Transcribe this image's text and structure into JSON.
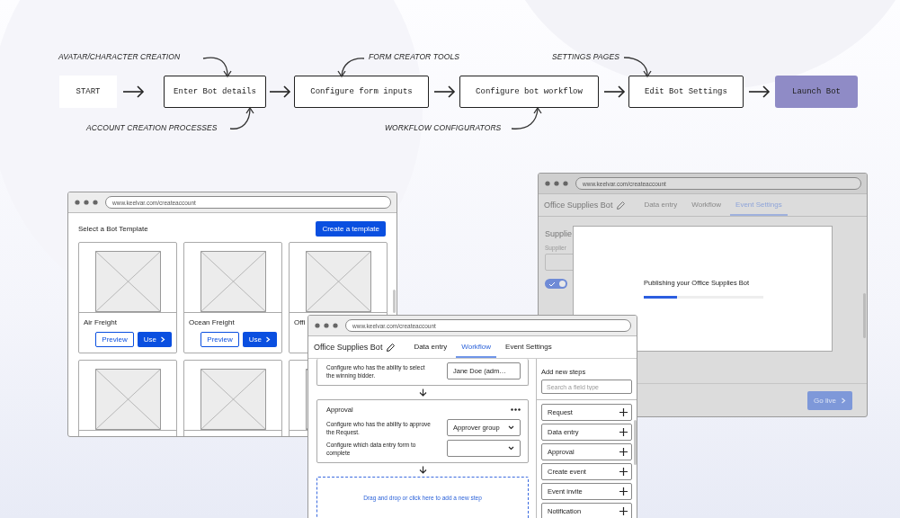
{
  "flow": {
    "steps": [
      {
        "label": "START",
        "kind": "start"
      },
      {
        "label": "Enter Bot details",
        "kind": "step"
      },
      {
        "label": "Configure form inputs",
        "kind": "step"
      },
      {
        "label": "Configure bot workflow",
        "kind": "step"
      },
      {
        "label": "Edit Bot Settings",
        "kind": "step"
      },
      {
        "label": "Launch Bot",
        "kind": "final"
      }
    ],
    "annotations": [
      {
        "text": "AVATAR/CHARACTER CREATION"
      },
      {
        "text": "ACCOUNT CREATION PROCESSES"
      },
      {
        "text": "FORM CREATOR TOOLS"
      },
      {
        "text": "WORKFLOW CONFIGURATORS"
      },
      {
        "text": "SETTINGS PAGES"
      }
    ]
  },
  "template_window": {
    "url": "www.keelvar.com/createaccount",
    "heading": "Select a Bot Template",
    "create_button": "Create a template",
    "cards": [
      {
        "kind": "template",
        "title": "Air Freight",
        "preview": "Preview",
        "use": "Use"
      },
      {
        "kind": "template",
        "title": "Ocean Freight",
        "preview": "Preview",
        "use": "Use"
      },
      {
        "kind": "template",
        "title": "Offi"
      },
      {
        "kind": "template"
      },
      {
        "kind": "template"
      },
      {
        "kind": "template"
      }
    ]
  },
  "settings_window": {
    "url": "www.keelvar.com/createaccount",
    "bot_name": "Office Supplies Bot",
    "tabs": [
      {
        "label": "Data entry",
        "selected": false
      },
      {
        "label": "Workflow",
        "selected": false
      },
      {
        "label": "Event Settings",
        "selected": true
      }
    ],
    "section_title": "Supplie",
    "field_label": "Supplier",
    "toggle": {
      "on": true
    },
    "modal": {
      "message": "Publishing your Office Supplies Bot",
      "progress": {
        "level": 0.28
      }
    },
    "go_live_button": "Go live"
  },
  "workflow_window": {
    "url": "www.keelvar.com/createaccount",
    "bot_name": "Office Supplies Bot",
    "tabs": [
      {
        "label": "Data entry",
        "selected": false
      },
      {
        "label": "Workflow",
        "selected": true
      },
      {
        "label": "Event Settings",
        "selected": false
      }
    ],
    "steps": [
      {
        "rows": [
          {
            "text": "Configure who has the ability to select the winning bidder.",
            "kind": "text",
            "value": "Jane Doe (adm…"
          }
        ]
      },
      {
        "title": "Approval",
        "rows": [
          {
            "text": "Configure who has the ability to approve the Request.",
            "kind": "select",
            "value": "Approver group"
          },
          {
            "text": "Configure which data entry form to complete",
            "kind": "select"
          }
        ]
      }
    ],
    "dropzone": "Drag and drop or click here to add a new step",
    "panel": {
      "heading": "Add new steps",
      "search_placeholder": "Search a field type",
      "items": [
        "Request",
        "Data entry",
        "Approval",
        "Create event",
        "Event invite",
        "Notification"
      ]
    }
  }
}
